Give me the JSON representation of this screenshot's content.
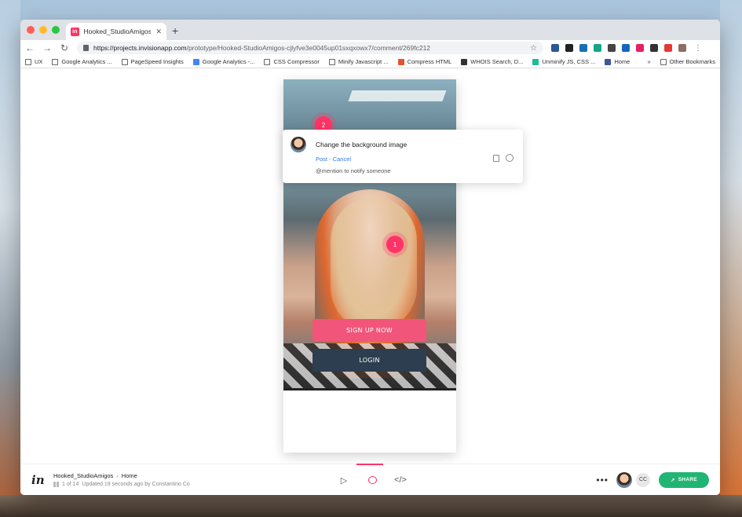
{
  "browser": {
    "tab_title": "Hooked_StudioAmigos - InVision",
    "tab_favicon": "in",
    "url_host": "https://projects.invisionapp.com",
    "url_path": "/prototype/Hooked-StudioAmigos-cjlyfve3e0045up01sxqxowx7/comment/269fc212",
    "bookmarks": [
      "UX",
      "Google Analytics ...",
      "PageSpeed Insights",
      "Google Analytics -...",
      "CSS Compressor",
      "Minify Javascript ...",
      "Compress HTML",
      "WHOIS Search, D...",
      "Unminify JS, CSS ...",
      "Home"
    ],
    "bookmarks_overflow": "»",
    "other_bookmarks": "Other Bookmarks",
    "extension_colors": [
      "#2b5797",
      "#222222",
      "#1a6fb5",
      "#17a589",
      "#444444",
      "#1565c0",
      "#e91e63",
      "#333333",
      "#e53935",
      "#8d6e63"
    ]
  },
  "prototype": {
    "hotspot_1": "1",
    "hotspot_2": "2",
    "signup_label": "SIGN UP NOW",
    "login_label": "LOGIN",
    "brand_color": "#f2557a",
    "login_color": "#2c3e50"
  },
  "comment": {
    "text": "Change the background image",
    "post_label": "Post",
    "separator": " - ",
    "cancel_label": "Cancel",
    "hint": "@mention to notify someone"
  },
  "bottombar": {
    "logo": "in",
    "project": "Hooked_StudioAmigos",
    "separator": "›",
    "screen": "Home",
    "page_of": "1 of 14",
    "updated": "Updated 19 seconds ago by Constantino Co",
    "more": "•••",
    "collaborator_initials": "CC",
    "share_label": "SHARE",
    "share_color": "#21b573",
    "accent": "#ff3366"
  }
}
